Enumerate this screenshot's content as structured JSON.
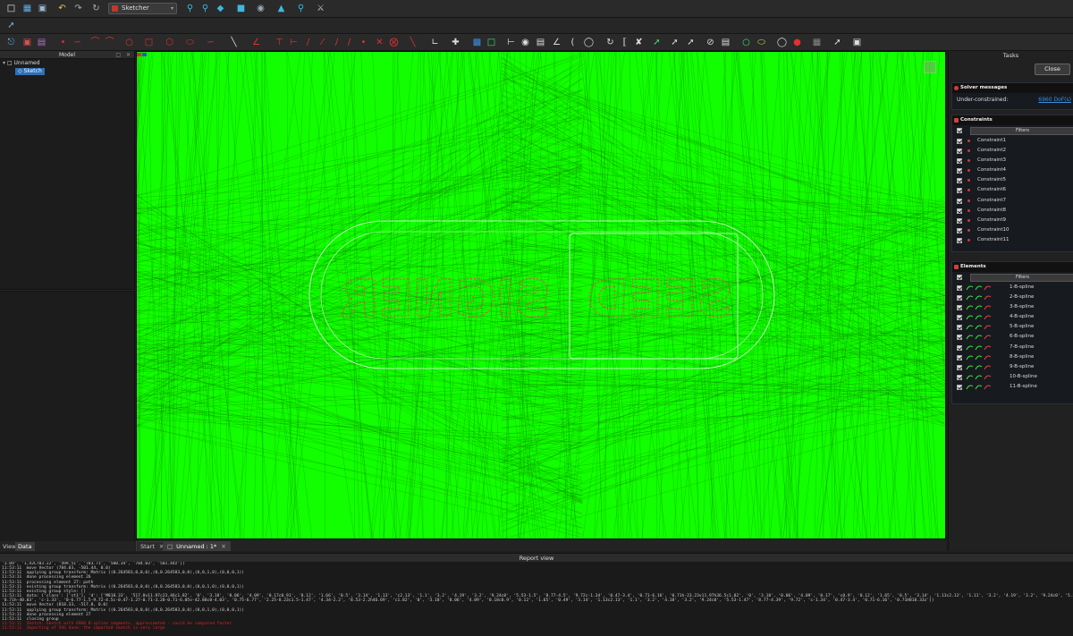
{
  "toolbar": {
    "workbench": "Sketcher"
  },
  "model_panel": {
    "title": "Model",
    "tree": {
      "document": "Unnamed",
      "sketch": "Sketch"
    },
    "tabs": [
      "View",
      "Data"
    ]
  },
  "doc_tabs": [
    "Start",
    "Unnamed : 1*"
  ],
  "tasks": {
    "title": "Tasks",
    "close_label": "Close",
    "solver": {
      "title": "Solver messages",
      "status": "Under-constrained:",
      "dof": "6960 DoF(s)"
    },
    "constraints": {
      "title": "Constraints",
      "filters_label": "Filters",
      "items": [
        "Constraint1",
        "Constraint2",
        "Constraint3",
        "Constraint4",
        "Constraint5",
        "Constraint6",
        "Constraint7",
        "Constraint8",
        "Constraint9",
        "Constraint10",
        "Constraint11"
      ]
    },
    "elements": {
      "title": "Elements",
      "filters_label": "Filters",
      "items": [
        "1-B-spline",
        "2-B-spline",
        "3-B-spline",
        "4-B-spline",
        "5-B-spline",
        "6-B-spline",
        "7-B-spline",
        "8-B-spline",
        "9-B-spline",
        "10-B-spline",
        "11-B-spline"
      ]
    }
  },
  "viewport": {
    "left_text": "SIGNER",
    "right_text": "SEED",
    "background": "#11ff00"
  },
  "report": {
    "title": "Report view",
    "lines": [
      "'3.09', '1,42C783.22', '499.51', '783.71', '500.34', '784.03', '501.44z'])",
      "11:53:11  move Vector (784.03, -501.44, 0.0)",
      "11:53:11  applying group transform: Matrix ((0.264583,0,0,0),(0,0.264583,0,0),(0,0,1,0),(0,0,0,1))",
      "11:53:11  done processing element 26",
      "11:53:11  processing element 27: path",
      "11:53:11  existing group transform: Matrix ((0.264583,0,0,0),(0,0.264583,0,0),(0,0,1,0),(0,0,0,1))",
      "11:53:11  existing group style: []",
      "11:53:11  data: {'class': ['st1'], 'd': ['M818.33', '517.8v11.97c23.46c1.82', '0', '3.18', '0.06', '4.09', '0.17c0.91', '0.12', '1.66', '0.5', '3.14', '1.13', 'c2.13', '1.1', '3.2', '4.19', '3.2', '9.24c0', '5.53-1.5', '8.77-4.5', '9.72c-1.34', '0.47-3.4', '0.71-6.16', '0.71h-23.23v11.97h36.5c1.82', '0', '3.18', '0.06', '4.09', '0.17', 'c0.9', '0.12', '1.65', '0.5', '3.14', '1.13c2.13', '1.11', '3.2', '4.19', '3.2', '9.24c0', '5.53-1.47', '8.77-4.39', '9.72c-1.34', '0.47-3.4', '0.71-6.16', '0.71h-32.73v11.97h-32.73',",
      "'0.71h-40.03', 'c-1.33', '0-6.77-1.5-9.72-4.5c-0.47-1.27-0.71-3.28-0.71-6.05v-42.88c0-4.03', '0.75-6.77', '2.25-8.23c1.5-1.47', '4.34-2.2', '8.53-2.2h46.69', 'c1.82', '0', '3.18', '0.06', '4.09', '0.18c0.9', '0.12', '1.65', '0.49', '3.14', '1.13c2.13', '1.1', '3.2', '4.18', '3.2', '9.24c0', '5.53-1.47', '8.77-4.39', '9.72', 'c-1.34', '0.47-3.4', '0.71-6.16', '0.71H818.33z'])",
      "11:53:11  move Vector (818.33, -517.8, 0.0)",
      "11:53:11  applying group transform: Matrix ((0.264583,0,0,0),(0,0.264583,0,0),(0,0,1,0),(0,0,0,1))",
      "11:53:11  done processing element 27",
      "11:53:11  closing group",
      "11:53:11  Sketch: Sketch with 6960 B-spline segments, approximated - could be computed faster",
      "11:53:11  Importing of SVG done: the imported sketch is very large"
    ]
  }
}
